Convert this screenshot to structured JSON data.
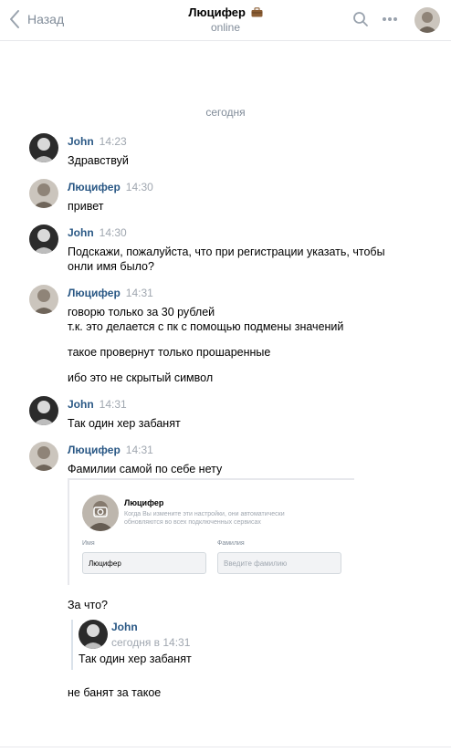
{
  "header": {
    "back_label": "Назад",
    "title": "Люцифер",
    "title_icon": "briefcase-emoji",
    "status": "online"
  },
  "date_separator": "сегодня",
  "messages": [
    {
      "author": "John",
      "time": "14:23",
      "lines": [
        "Здравствуй"
      ]
    },
    {
      "author": "Люцифер",
      "time": "14:30",
      "lines": [
        "привет"
      ]
    },
    {
      "author": "John",
      "time": "14:30",
      "lines": [
        "Подскажи, пожалуйста, что при регистрации указать, чтобы",
        "онли имя было?"
      ]
    },
    {
      "author": "Люцифер",
      "time": "14:31",
      "lines": [
        "говорю только за 30 рублей",
        "т.к. это делается с пк с помощью подмены значений",
        "такое провернут только прошаренные",
        "ибо это не скрытый символ"
      ]
    },
    {
      "author": "John",
      "time": "14:31",
      "lines": [
        "Так один хер забанят"
      ]
    },
    {
      "author": "Люцифер",
      "time": "14:31",
      "lines": [
        "Фамилии самой по себе нету"
      ]
    }
  ],
  "attachment": {
    "name": "Люцифер",
    "note": "Когда Вы измените эти настройки, они автоматически обновляются во всех подключенных сервисах",
    "first_name_label": "Имя",
    "first_name_value": "Люцифер",
    "last_name_label": "Фамилия",
    "last_name_placeholder": "Введите фамилию"
  },
  "followup_1": "За что?",
  "quote": {
    "author": "John",
    "time": "сегодня в 14:31",
    "text": "Так один хер забанят"
  },
  "followup_2": "не банят за такое",
  "colors": {
    "link": "#2a5885",
    "muted": "#818c99",
    "divider": "#e7e8ec"
  }
}
